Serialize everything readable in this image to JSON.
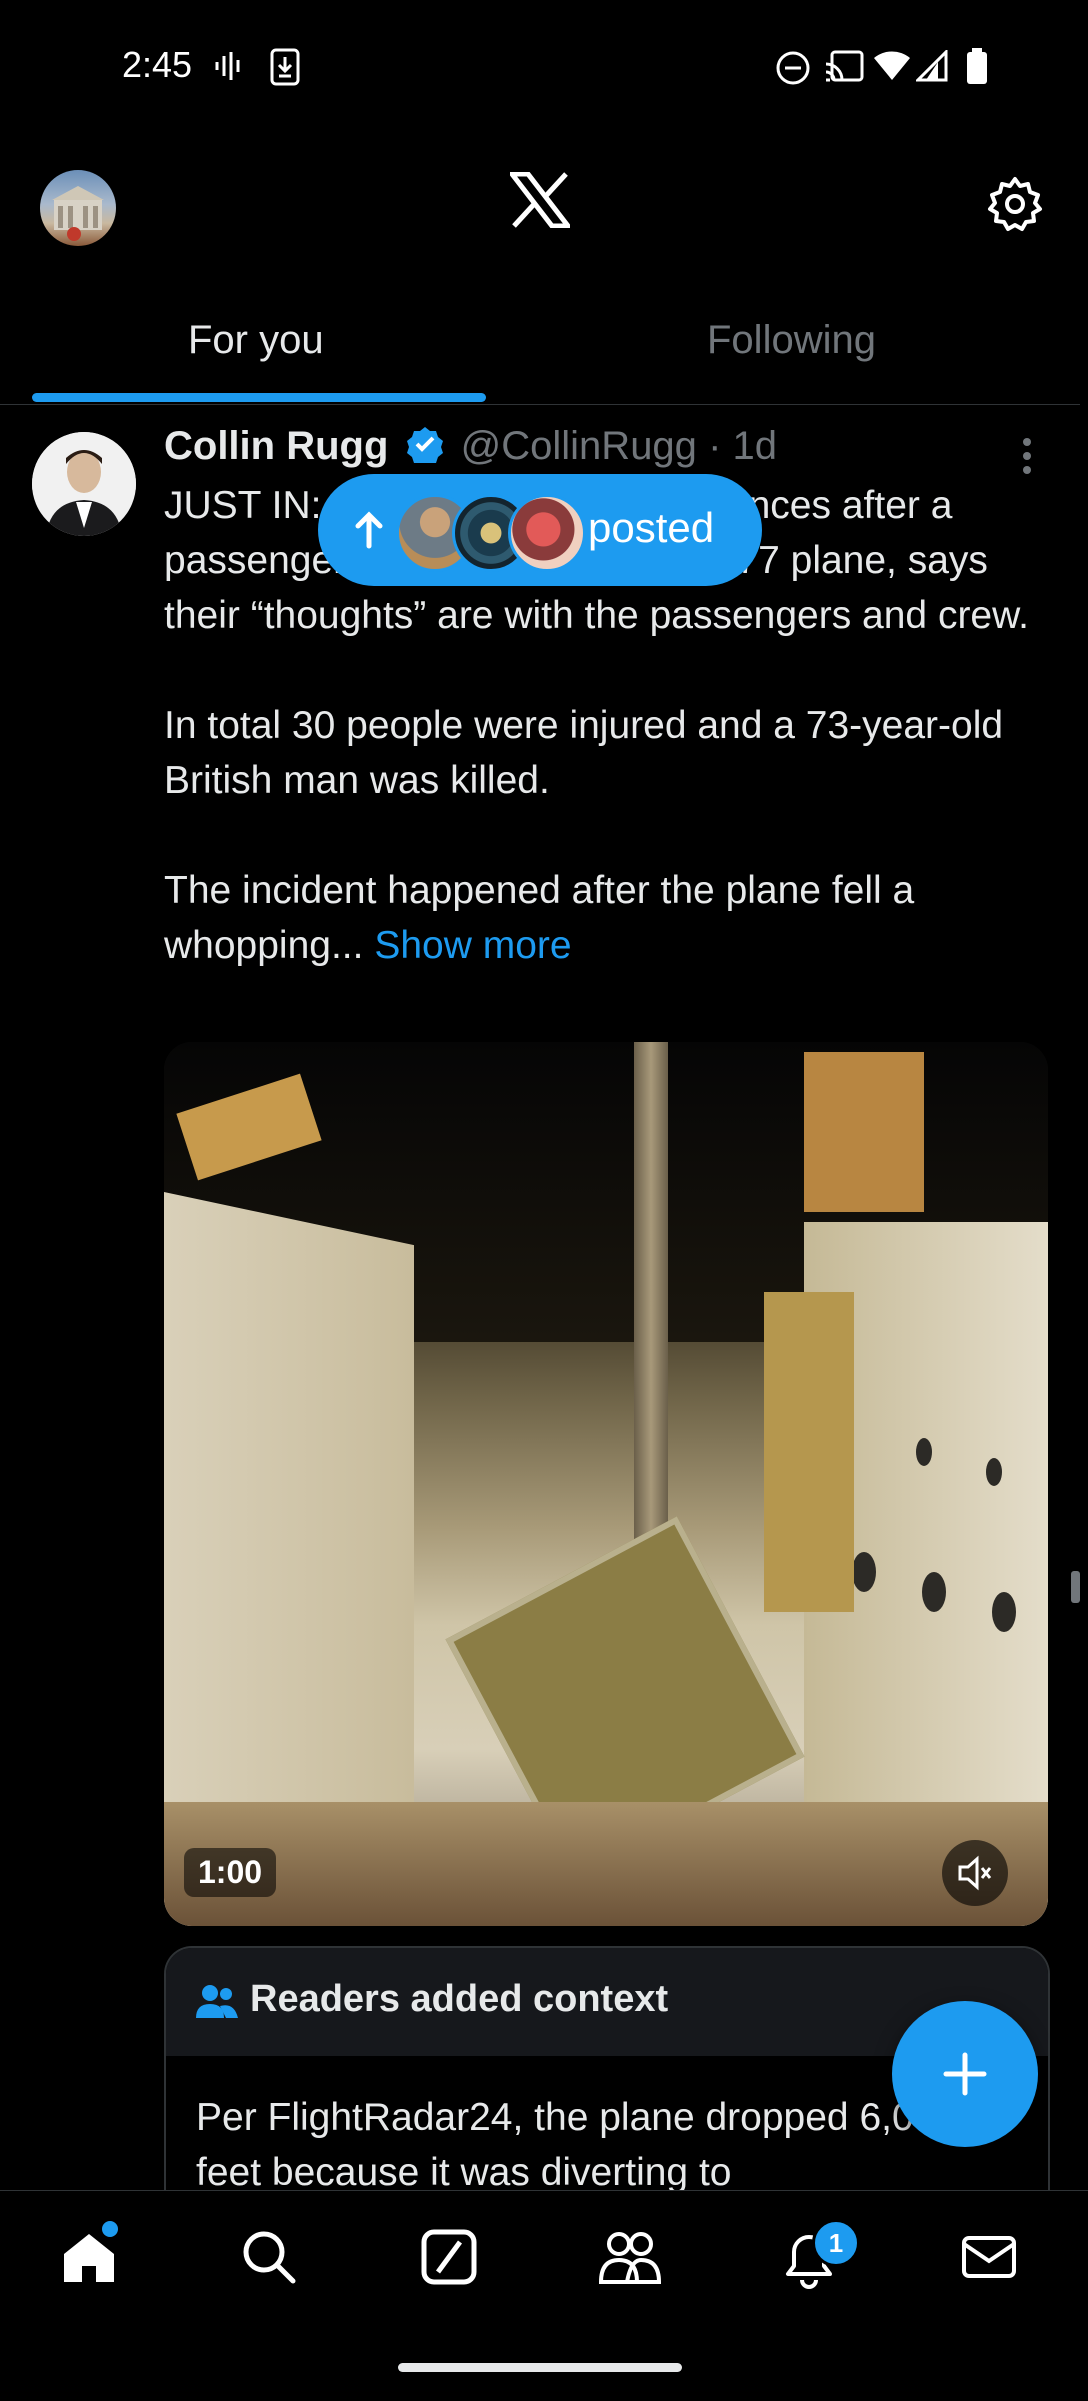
{
  "status_bar": {
    "time": "2:45"
  },
  "tabs": [
    {
      "label": "For you",
      "selected": true
    },
    {
      "label": "Following",
      "selected": false
    }
  ],
  "tweet": {
    "author_name": "Collin Rugg",
    "handle": "@CollinRugg",
    "time": "· 1d",
    "text": "JUST IN: Boeing extends condolences after a passenger died on their Boeing 777 plane, says their “thoughts” are with the passengers and crew.\n\nIn total 30 people were injured and a 73-year-old British man was killed.\n\nThe incident happened after the plane fell a whopping... ",
    "show_more": "Show more",
    "video_duration": "1:00",
    "context": {
      "title": "Readers added context",
      "text": "Per FlightRadar24, the plane dropped 6,000 feet because it was diverting to"
    }
  },
  "posted_pill": {
    "label": "posted"
  },
  "notifications_badge": "1",
  "colors": {
    "accent": "#1d9bf0",
    "background": "#000000",
    "secondary_text": "#71767b"
  },
  "icons": [
    "x-logo-icon",
    "settings-icon",
    "verified-icon",
    "more-icon",
    "home-icon",
    "search-icon",
    "grok-icon",
    "communities-icon",
    "notifications-icon",
    "messages-icon",
    "compose-icon",
    "mute-icon",
    "people-icon",
    "arrow-up-icon"
  ]
}
